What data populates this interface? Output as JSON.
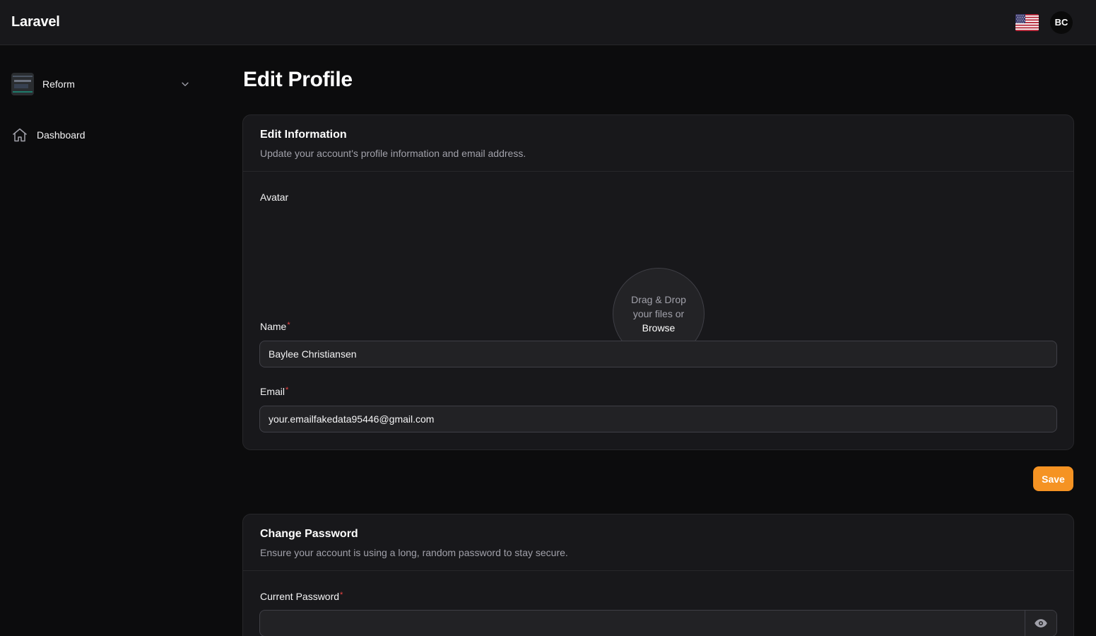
{
  "app": {
    "brand": "Laravel",
    "user_initials": "BC",
    "locale_icon": "us-flag-icon"
  },
  "sidebar": {
    "tenant": {
      "name": "Reform"
    },
    "items": [
      {
        "label": "Dashboard",
        "icon": "home-icon"
      }
    ]
  },
  "page": {
    "title": "Edit Profile"
  },
  "edit_info": {
    "title": "Edit Information",
    "description": "Update your account's profile information and email address.",
    "avatar_label": "Avatar",
    "dropzone_line1": "Drag & Drop",
    "dropzone_line2": "your files or",
    "dropzone_browse": "Browse",
    "name_label": "Name",
    "name_value": "Baylee Christiansen",
    "email_label": "Email",
    "email_value": "your.emailfakedata95446@gmail.com",
    "required_mark": "*"
  },
  "actions": {
    "save_label": "Save"
  },
  "change_password": {
    "title": "Change Password",
    "description": "Ensure your account is using a long, random password to stay secure.",
    "current_label": "Current Password",
    "current_value": ""
  },
  "colors": {
    "accent": "#f59323",
    "required": "#ef4444"
  }
}
